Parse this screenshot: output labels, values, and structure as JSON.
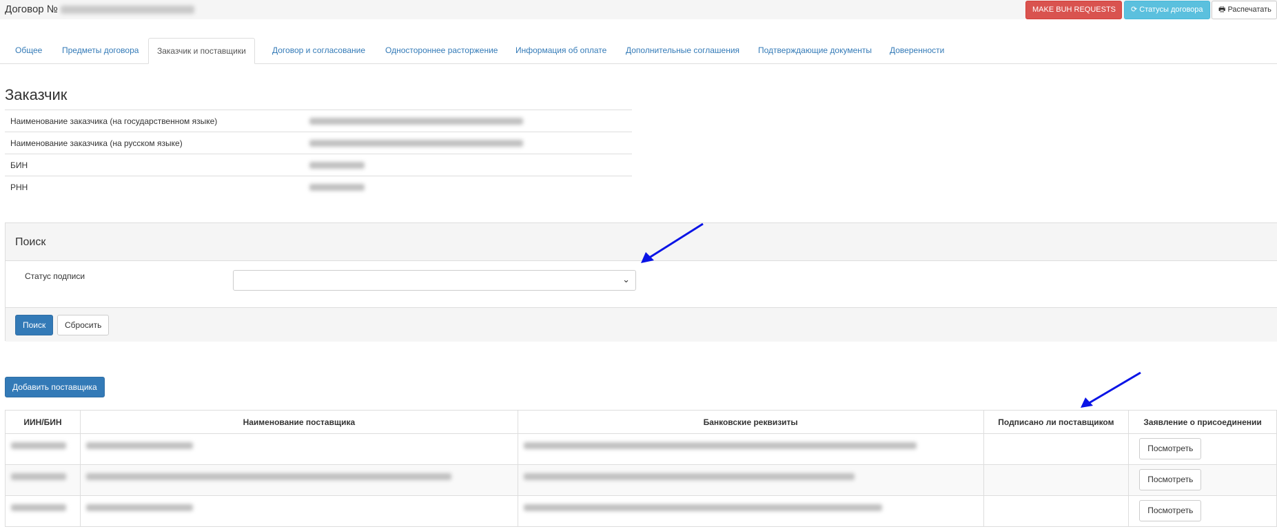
{
  "header": {
    "contract_label": "Договор №",
    "buttons": {
      "make_buh": "MAKE BUH REQUESTS",
      "statuses": "Статусы договора",
      "print": "Распечатать"
    },
    "icons": {
      "statuses": "refresh-icon",
      "print": "print-icon"
    },
    "colors": {
      "danger": "#d9534f",
      "info": "#5bc0de",
      "primary": "#337ab7"
    }
  },
  "tabs": [
    {
      "label": "Общее"
    },
    {
      "label": "Предметы договора"
    },
    {
      "label": "Заказчик и поставщики",
      "active": true
    },
    {
      "label": "Договор и согласование"
    },
    {
      "label": "Одностороннее расторжение"
    },
    {
      "label": "Информация об оплате"
    },
    {
      "label": "Дополнительные соглашения"
    },
    {
      "label": "Подтверждающие документы"
    },
    {
      "label": "Доверенности"
    }
  ],
  "customer": {
    "heading": "Заказчик",
    "rows": [
      {
        "label": "Наименование заказчика (на государственном языке)"
      },
      {
        "label": "Наименование заказчика (на русском языке)"
      },
      {
        "label": "БИН"
      },
      {
        "label": "РНН"
      }
    ]
  },
  "search": {
    "heading": "Поиск",
    "status_label": "Статус подписи",
    "status_value": "",
    "search_button": "Поиск",
    "reset_button": "Сбросить"
  },
  "suppliers": {
    "add_button": "Добавить поставщика",
    "columns": [
      "ИИН/БИН",
      "Наименование поставщика",
      "Банковские реквизиты",
      "Подписано ли поставщиком",
      "Заявление о присоединении"
    ],
    "view_label": "Посмотреть",
    "rows": [
      {
        "signed": ""
      },
      {
        "signed": ""
      },
      {
        "signed": ""
      }
    ]
  },
  "annotations": {
    "arrow_color": "#0a14e6"
  }
}
